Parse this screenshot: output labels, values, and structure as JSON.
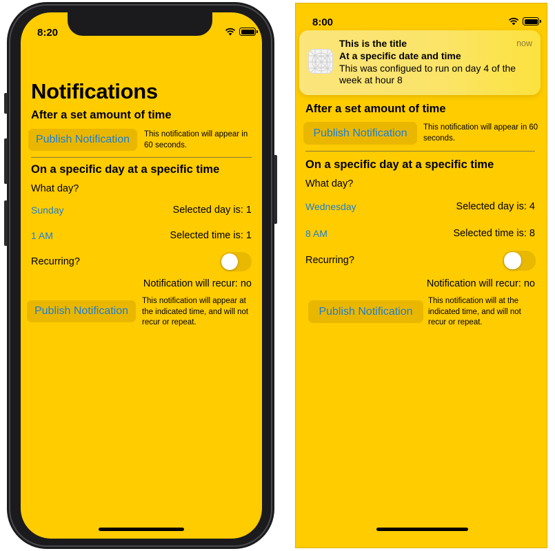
{
  "left": {
    "status_time": "8:20",
    "title": "Notifications",
    "section1_title": "After a set amount of time",
    "publish_label": "Publish Notification",
    "section1_desc": "This notification will appear in 60 seconds.",
    "section2_title": "On a specific day at a specific time",
    "what_day": "What day?",
    "day_value": "Sunday",
    "selected_day": "Selected day is: 1",
    "time_value": "1 AM",
    "selected_time": "Selected time is: 1",
    "recurring_label": "Recurring?",
    "recur_status": "Notification will recur: no",
    "publish_label2": "Publish Notification",
    "section2_desc": "This notification will appear at the indicated time, and will not recur or repeat.",
    "recurring_on": false
  },
  "right": {
    "status_time": "8:00",
    "banner": {
      "title": "This is the title",
      "subtitle": "At a specific date and time",
      "body": "This was configued to run on day 4 of the week at hour 8",
      "time": "now"
    },
    "section1_title": "After a set amount of time",
    "publish_label": "Publish Notification",
    "section1_desc": "This notification will appear in 60 seconds.",
    "section2_title": "On a specific day at a specific time",
    "what_day": "What day?",
    "day_value": "Wednesday",
    "selected_day": "Selected day is: 4",
    "time_value": "8 AM",
    "selected_time": "Selected time is: 8",
    "recurring_label": "Recurring?",
    "recur_status": "Notification will recur: no",
    "publish_label2": "Publish Notification",
    "section2_desc": "This notification will at the indicated time, and will not recur or repeat.",
    "recurring_on": false
  },
  "colors": {
    "background": "#ffcc00",
    "accent": "#1a7ed6",
    "button_bg": "#eab700"
  }
}
